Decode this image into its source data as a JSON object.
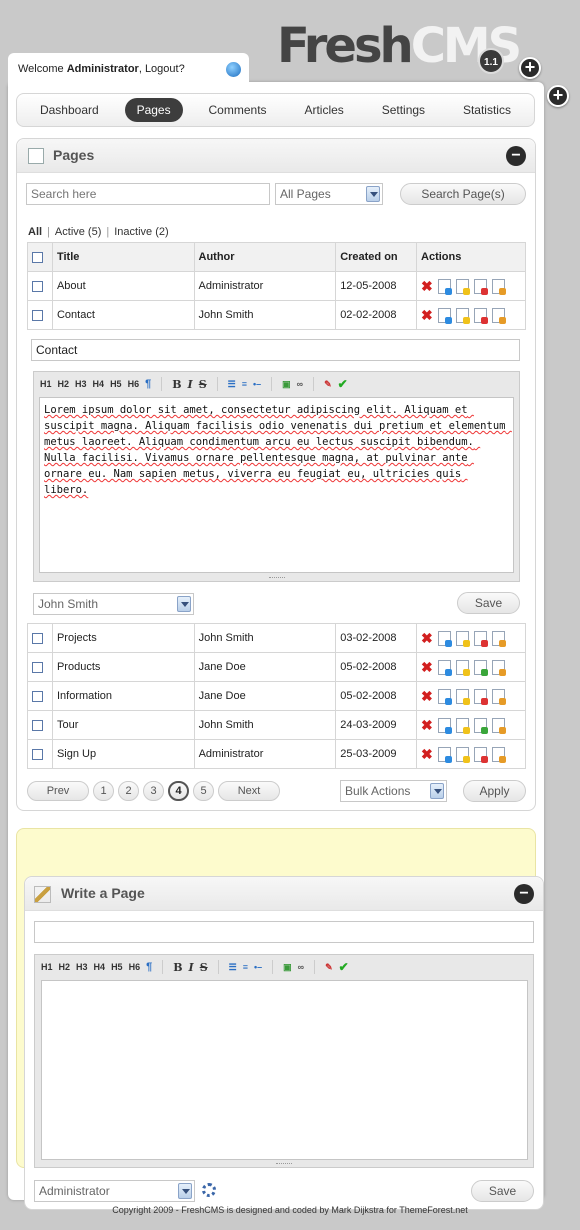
{
  "app": {
    "logo_part1": "Fresh",
    "logo_part2": "CMS",
    "version": "1.1"
  },
  "header": {
    "welcome_prefix": "Welcome ",
    "welcome_user": "Administrator",
    "welcome_suffix": ", Logout?"
  },
  "nav": {
    "items": [
      {
        "label": "Dashboard",
        "active": false
      },
      {
        "label": "Pages",
        "active": true
      },
      {
        "label": "Comments",
        "active": false
      },
      {
        "label": "Articles",
        "active": false
      },
      {
        "label": "Settings",
        "active": false
      },
      {
        "label": "Statistics",
        "active": false
      }
    ]
  },
  "pages_box": {
    "title": "Pages",
    "search_placeholder": "Search here",
    "filter_select": "All Pages",
    "search_button": "Search Page(s)",
    "filters": {
      "all": "All",
      "active": "Active (5)",
      "inactive": "Inactive (2)"
    },
    "columns": {
      "title": "Title",
      "author": "Author",
      "created": "Created on",
      "actions": "Actions"
    },
    "rows_top": [
      {
        "title": "About",
        "author": "Administrator",
        "date": "12-05-2008"
      },
      {
        "title": "Contact",
        "author": "John Smith",
        "date": "02-02-2008"
      }
    ],
    "rows_bottom": [
      {
        "title": "Projects",
        "author": "John Smith",
        "date": "03-02-2008"
      },
      {
        "title": "Products",
        "author": "Jane Doe",
        "date": "05-02-2008"
      },
      {
        "title": "Information",
        "author": "Jane Doe",
        "date": "05-02-2008"
      },
      {
        "title": "Tour",
        "author": "John Smith",
        "date": "24-03-2009"
      },
      {
        "title": "Sign Up",
        "author": "Administrator",
        "date": "25-03-2009"
      }
    ],
    "edit": {
      "title_value": "Contact",
      "body_text": "Lorem ipsum dolor sit amet, consectetur adipiscing elit. Aliquam et suscipit magna. Aliquam facilisis odio venenatis dui pretium et elementum metus laoreet. Aliquam condimentum arcu eu lectus suscipit bibendum. Nulla facilisi. Vivamus ornare pellentesque magna, at pulvinar ante ornare eu. Nam sapien metus, viverra eu feugiat eu, ultricies quis libero.",
      "author_select": "John Smith",
      "save_button": "Save"
    },
    "pager": {
      "prev": "Prev",
      "pages": [
        "1",
        "2",
        "3",
        "4",
        "5"
      ],
      "current": "4",
      "next": "Next"
    },
    "bulk_select": "Bulk Actions",
    "apply_button": "Apply"
  },
  "toolbar": {
    "h1": "H1",
    "h2": "H2",
    "h3": "H3",
    "h4": "H4",
    "h5": "H5",
    "h6": "H6",
    "para": "¶",
    "bold": "B",
    "italic": "I",
    "strike": "S"
  },
  "write_box": {
    "title": "Write a Page",
    "author_select": "Administrator",
    "save_button": "Save"
  },
  "footer": {
    "text": "Copyright 2009 - FreshCMS is designed and coded by Mark Dijkstra for ThemeForest.net"
  }
}
